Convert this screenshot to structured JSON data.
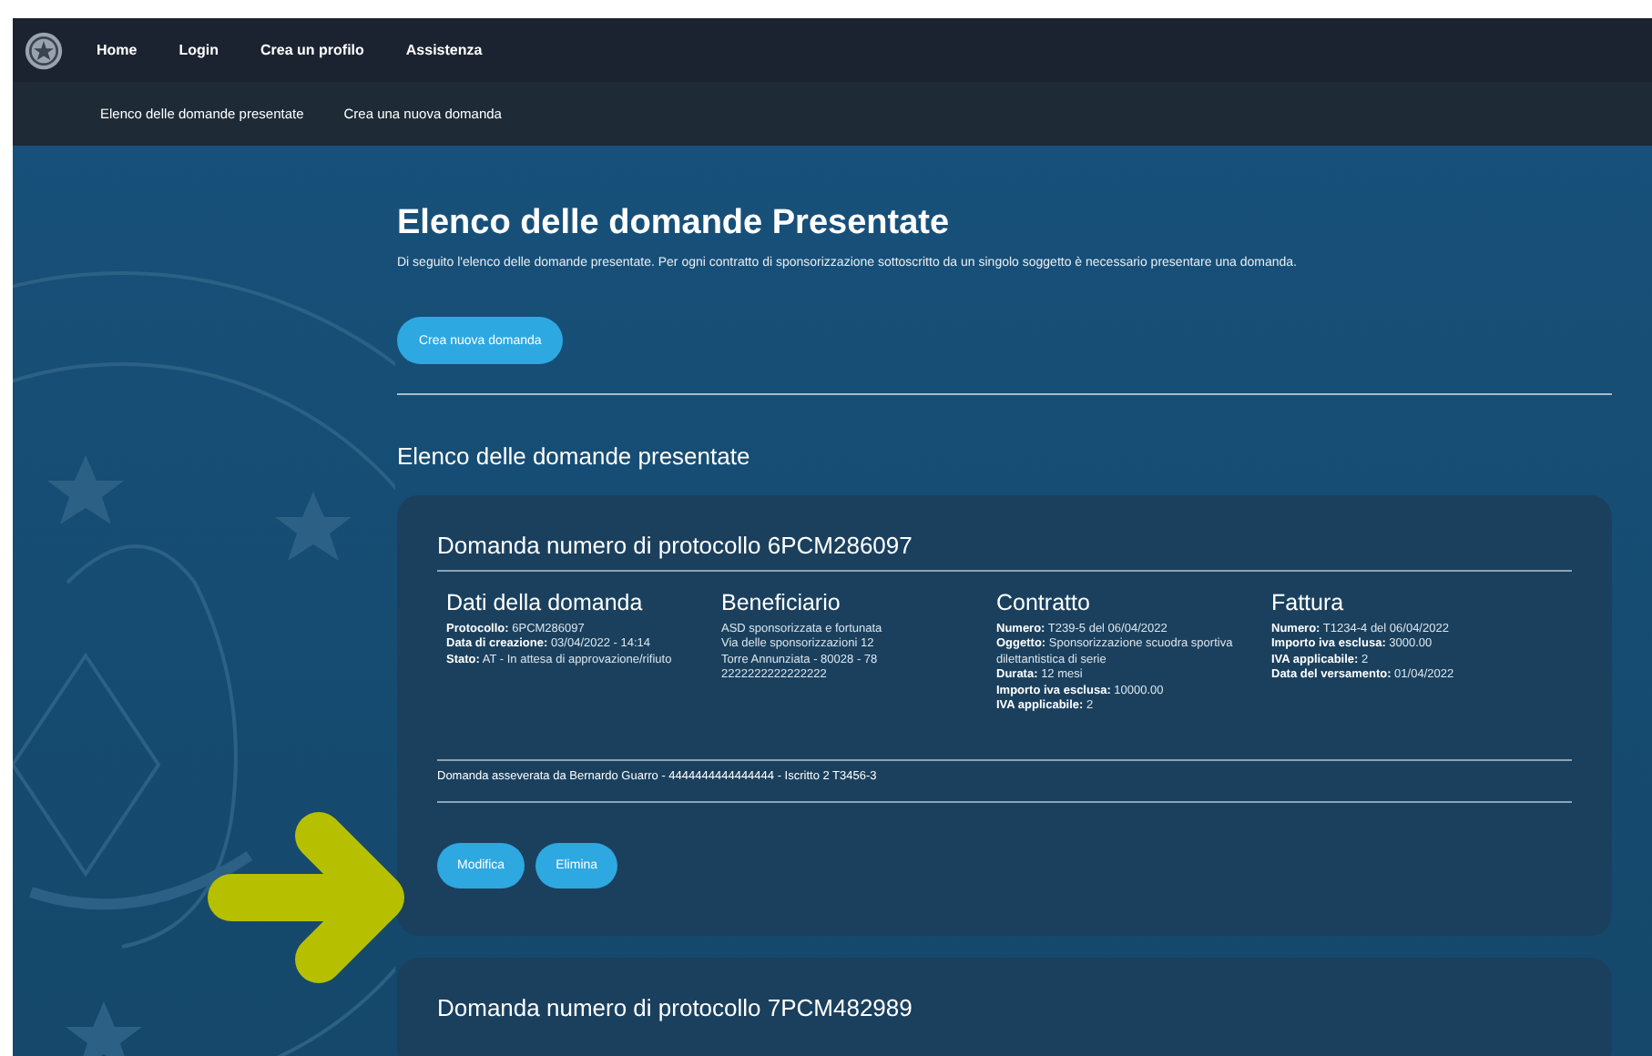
{
  "nav": {
    "items": [
      "Home",
      "Login",
      "Crea un profilo",
      "Assistenza"
    ]
  },
  "subnav": {
    "items": [
      "Elenco delle domande presentate",
      "Crea una nuova domanda"
    ]
  },
  "page": {
    "title": "Elenco delle domande Presentate",
    "description": "Di seguito l'elenco delle domande presentate. Per ogni contratto di sponsorizzazione sottoscritto da un singolo soggetto è necessario presentare una domanda.",
    "create_button": "Crea nuova domanda",
    "section_heading": "Elenco delle domande presentate"
  },
  "cards": [
    {
      "title": "Domanda numero di protocollo 6PCM286097",
      "columns": [
        {
          "heading": "Dati della domanda",
          "lines": [
            "**Protocollo:** 6PCM286097",
            "**Data di creazione:** 03/04/2022 - 14:14",
            "**Stato:** AT - In attesa di approvazione/rifiuto"
          ]
        },
        {
          "heading": "Beneficiario",
          "lines": [
            "ASD sponsorizzata e fortunata",
            "Via delle sponsorizzazioni 12",
            "Torre Annunziata - 80028 - 78",
            "2222222222222222"
          ]
        },
        {
          "heading": "Contratto",
          "lines": [
            "**Numero:** T239-5 del 06/04/2022",
            "**Oggetto:** Sponsorizzazione scuodra sportiva dilettantistica di serie",
            "**Durata:** 12 mesi",
            "**Importo iva esclusa:** 10000.00",
            "**IVA applicabile:** 2"
          ]
        },
        {
          "heading": "Fattura",
          "lines": [
            "**Numero:** T1234-4 del 06/04/2022",
            "**Importo iva esclusa:** 3000.00",
            "**IVA applicabile:** 2",
            "**Data del versamento:** 01/04/2022"
          ]
        }
      ],
      "footer": "Domanda asseverata da Bernardo Guarro - 4444444444444444 - Iscritto 2 T3456-3",
      "buttons": [
        "Modifica",
        "Elimina"
      ]
    },
    {
      "title": "Domanda numero di protocollo 7PCM482989"
    }
  ]
}
